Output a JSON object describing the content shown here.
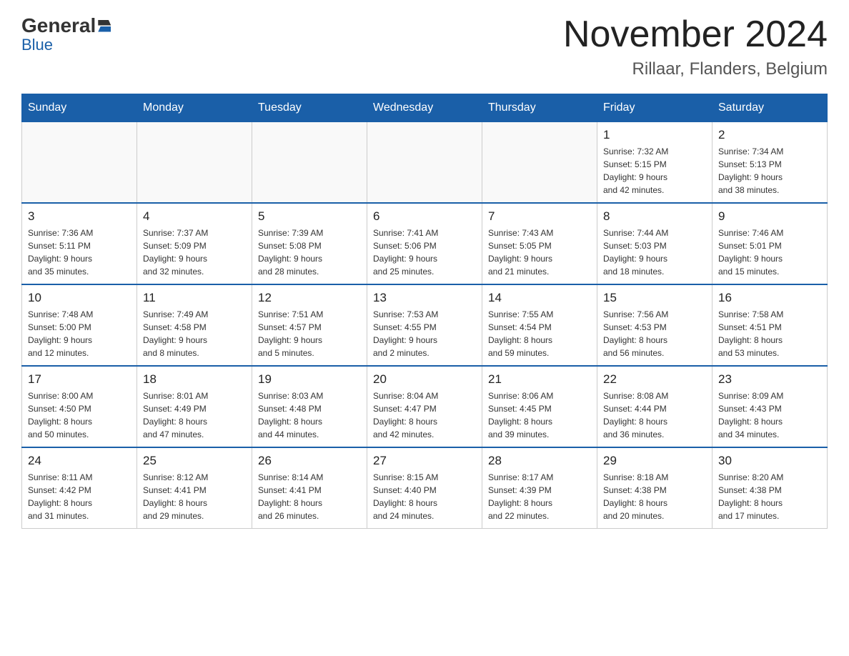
{
  "header": {
    "logo_general": "General",
    "logo_blue": "Blue",
    "month_title": "November 2024",
    "location": "Rillaar, Flanders, Belgium"
  },
  "days_of_week": [
    "Sunday",
    "Monday",
    "Tuesday",
    "Wednesday",
    "Thursday",
    "Friday",
    "Saturday"
  ],
  "weeks": [
    [
      {
        "day": "",
        "info": ""
      },
      {
        "day": "",
        "info": ""
      },
      {
        "day": "",
        "info": ""
      },
      {
        "day": "",
        "info": ""
      },
      {
        "day": "",
        "info": ""
      },
      {
        "day": "1",
        "info": "Sunrise: 7:32 AM\nSunset: 5:15 PM\nDaylight: 9 hours\nand 42 minutes."
      },
      {
        "day": "2",
        "info": "Sunrise: 7:34 AM\nSunset: 5:13 PM\nDaylight: 9 hours\nand 38 minutes."
      }
    ],
    [
      {
        "day": "3",
        "info": "Sunrise: 7:36 AM\nSunset: 5:11 PM\nDaylight: 9 hours\nand 35 minutes."
      },
      {
        "day": "4",
        "info": "Sunrise: 7:37 AM\nSunset: 5:09 PM\nDaylight: 9 hours\nand 32 minutes."
      },
      {
        "day": "5",
        "info": "Sunrise: 7:39 AM\nSunset: 5:08 PM\nDaylight: 9 hours\nand 28 minutes."
      },
      {
        "day": "6",
        "info": "Sunrise: 7:41 AM\nSunset: 5:06 PM\nDaylight: 9 hours\nand 25 minutes."
      },
      {
        "day": "7",
        "info": "Sunrise: 7:43 AM\nSunset: 5:05 PM\nDaylight: 9 hours\nand 21 minutes."
      },
      {
        "day": "8",
        "info": "Sunrise: 7:44 AM\nSunset: 5:03 PM\nDaylight: 9 hours\nand 18 minutes."
      },
      {
        "day": "9",
        "info": "Sunrise: 7:46 AM\nSunset: 5:01 PM\nDaylight: 9 hours\nand 15 minutes."
      }
    ],
    [
      {
        "day": "10",
        "info": "Sunrise: 7:48 AM\nSunset: 5:00 PM\nDaylight: 9 hours\nand 12 minutes."
      },
      {
        "day": "11",
        "info": "Sunrise: 7:49 AM\nSunset: 4:58 PM\nDaylight: 9 hours\nand 8 minutes."
      },
      {
        "day": "12",
        "info": "Sunrise: 7:51 AM\nSunset: 4:57 PM\nDaylight: 9 hours\nand 5 minutes."
      },
      {
        "day": "13",
        "info": "Sunrise: 7:53 AM\nSunset: 4:55 PM\nDaylight: 9 hours\nand 2 minutes."
      },
      {
        "day": "14",
        "info": "Sunrise: 7:55 AM\nSunset: 4:54 PM\nDaylight: 8 hours\nand 59 minutes."
      },
      {
        "day": "15",
        "info": "Sunrise: 7:56 AM\nSunset: 4:53 PM\nDaylight: 8 hours\nand 56 minutes."
      },
      {
        "day": "16",
        "info": "Sunrise: 7:58 AM\nSunset: 4:51 PM\nDaylight: 8 hours\nand 53 minutes."
      }
    ],
    [
      {
        "day": "17",
        "info": "Sunrise: 8:00 AM\nSunset: 4:50 PM\nDaylight: 8 hours\nand 50 minutes."
      },
      {
        "day": "18",
        "info": "Sunrise: 8:01 AM\nSunset: 4:49 PM\nDaylight: 8 hours\nand 47 minutes."
      },
      {
        "day": "19",
        "info": "Sunrise: 8:03 AM\nSunset: 4:48 PM\nDaylight: 8 hours\nand 44 minutes."
      },
      {
        "day": "20",
        "info": "Sunrise: 8:04 AM\nSunset: 4:47 PM\nDaylight: 8 hours\nand 42 minutes."
      },
      {
        "day": "21",
        "info": "Sunrise: 8:06 AM\nSunset: 4:45 PM\nDaylight: 8 hours\nand 39 minutes."
      },
      {
        "day": "22",
        "info": "Sunrise: 8:08 AM\nSunset: 4:44 PM\nDaylight: 8 hours\nand 36 minutes."
      },
      {
        "day": "23",
        "info": "Sunrise: 8:09 AM\nSunset: 4:43 PM\nDaylight: 8 hours\nand 34 minutes."
      }
    ],
    [
      {
        "day": "24",
        "info": "Sunrise: 8:11 AM\nSunset: 4:42 PM\nDaylight: 8 hours\nand 31 minutes."
      },
      {
        "day": "25",
        "info": "Sunrise: 8:12 AM\nSunset: 4:41 PM\nDaylight: 8 hours\nand 29 minutes."
      },
      {
        "day": "26",
        "info": "Sunrise: 8:14 AM\nSunset: 4:41 PM\nDaylight: 8 hours\nand 26 minutes."
      },
      {
        "day": "27",
        "info": "Sunrise: 8:15 AM\nSunset: 4:40 PM\nDaylight: 8 hours\nand 24 minutes."
      },
      {
        "day": "28",
        "info": "Sunrise: 8:17 AM\nSunset: 4:39 PM\nDaylight: 8 hours\nand 22 minutes."
      },
      {
        "day": "29",
        "info": "Sunrise: 8:18 AM\nSunset: 4:38 PM\nDaylight: 8 hours\nand 20 minutes."
      },
      {
        "day": "30",
        "info": "Sunrise: 8:20 AM\nSunset: 4:38 PM\nDaylight: 8 hours\nand 17 minutes."
      }
    ]
  ]
}
